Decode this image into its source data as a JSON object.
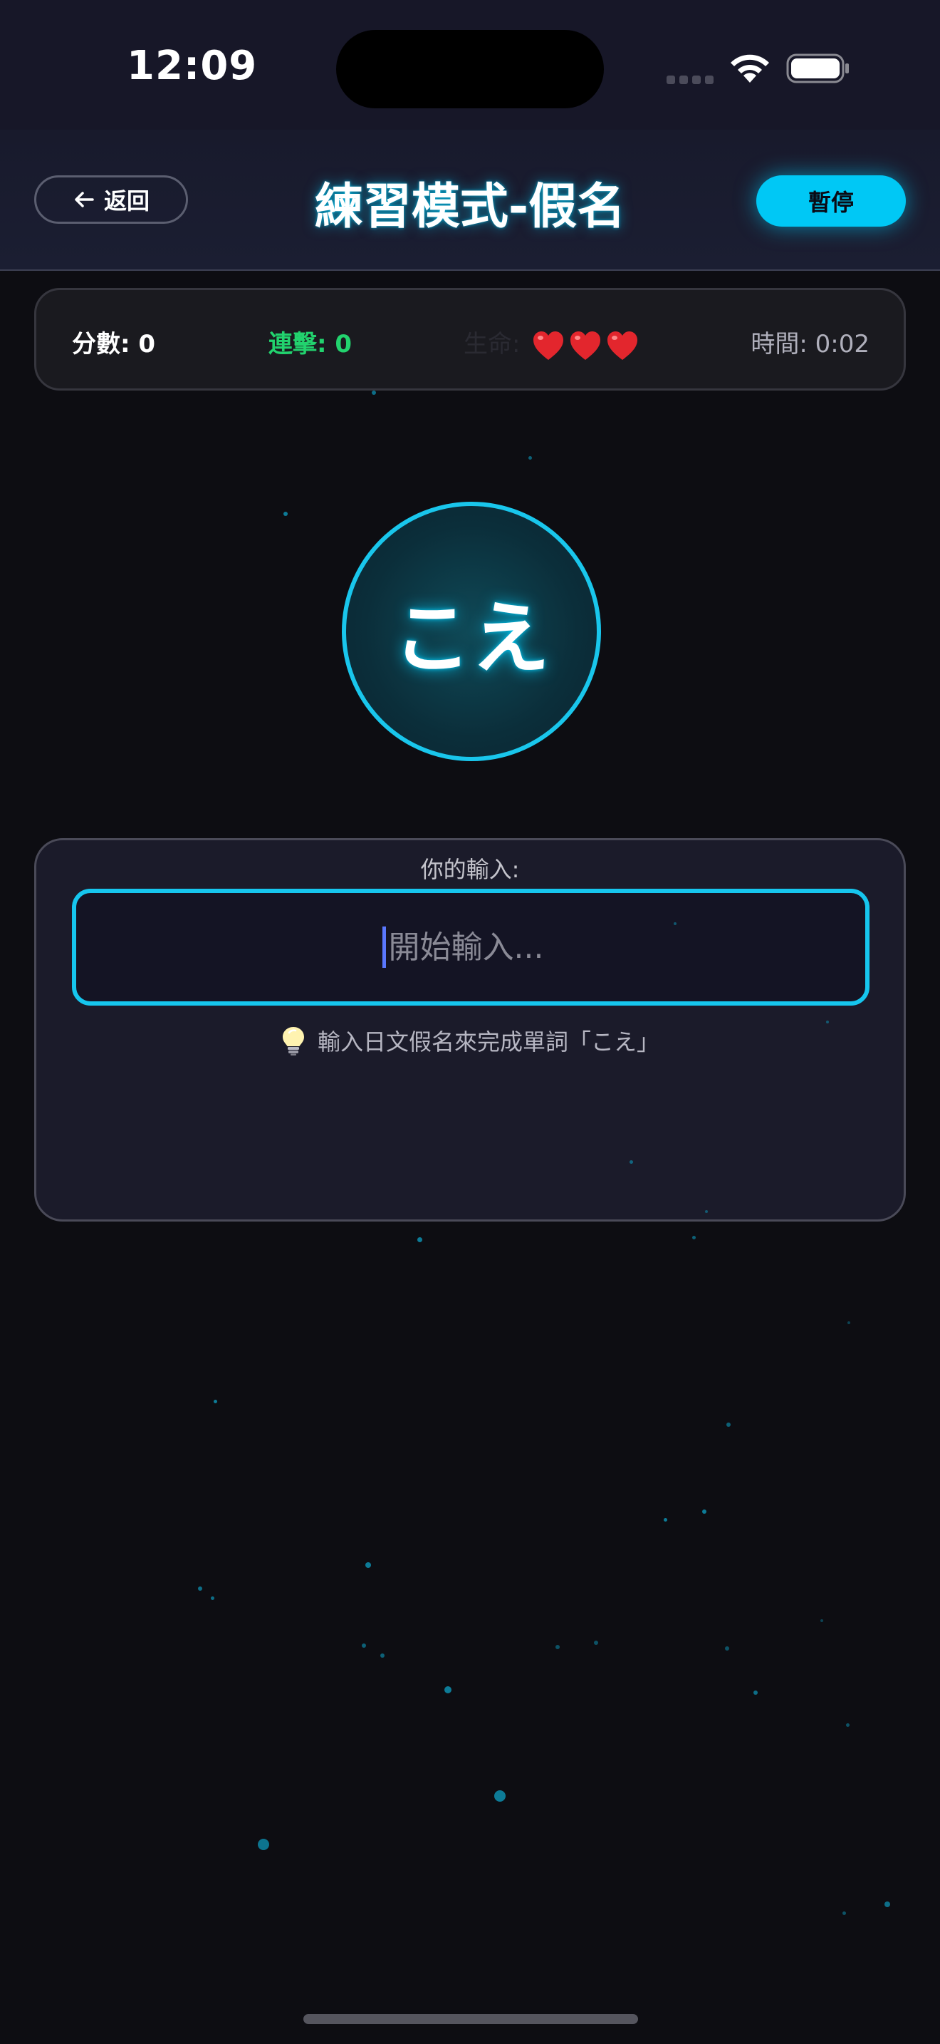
{
  "status_bar": {
    "time": "12:09"
  },
  "header": {
    "back_label": "返回",
    "title": "練習模式-假名",
    "pause_label": "暫停"
  },
  "stats": {
    "score": "分數: 0",
    "combo": "連擊: 0",
    "lives_label": "生命:",
    "lives_count": 3,
    "time": "時間: 0:02"
  },
  "word": {
    "kana": "こえ"
  },
  "input": {
    "label": "你的輸入:",
    "placeholder": "開始輸入...",
    "value": "",
    "hint": "輸入日文假名來完成單詞「こえ」"
  },
  "colors": {
    "accent": "#00c8f5",
    "combo": "#22d36e",
    "heart": "#e3262d",
    "background": "#0d0d12"
  },
  "icons": {
    "back": "arrow-left-icon",
    "hint": "lightbulb-icon",
    "life": "heart-icon"
  }
}
